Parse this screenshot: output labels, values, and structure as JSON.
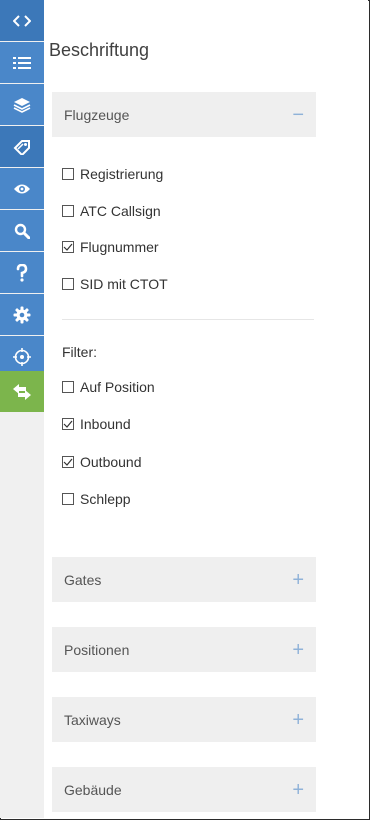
{
  "panel": {
    "title": "Beschriftung"
  },
  "sidebar": {
    "items": [
      {
        "icon": "code-brackets-icon",
        "state": "active-dark"
      },
      {
        "icon": "list-icon",
        "state": "active"
      },
      {
        "icon": "layers-icon",
        "state": "active"
      },
      {
        "icon": "tag-icon",
        "state": "active-dark"
      },
      {
        "icon": "eye-icon",
        "state": "active"
      },
      {
        "icon": "search-icon",
        "state": "active"
      },
      {
        "icon": "help-icon",
        "state": "active"
      },
      {
        "icon": "gear-icon",
        "state": "active"
      },
      {
        "icon": "crosshair-icon",
        "state": "active"
      },
      {
        "icon": "swap-arrows-icon",
        "state": "highlight"
      }
    ],
    "colors": {
      "blue": "#4a87c9",
      "blue_dark": "#3c78b9",
      "green": "#7cb54c"
    }
  },
  "sections": {
    "flugzeuge": {
      "label": "Flugzeuge",
      "toggle": "−",
      "expanded": true,
      "options": [
        {
          "label": "Registrierung",
          "checked": false
        },
        {
          "label": "ATC Callsign",
          "checked": false
        },
        {
          "label": "Flugnummer",
          "checked": true
        },
        {
          "label": "SID mit CTOT",
          "checked": false
        }
      ],
      "filter_label": "Filter:",
      "filters": [
        {
          "label": "Auf Position",
          "checked": false
        },
        {
          "label": "Inbound",
          "checked": true
        },
        {
          "label": "Outbound",
          "checked": true
        },
        {
          "label": "Schlepp",
          "checked": false
        }
      ]
    },
    "gates": {
      "label": "Gates",
      "toggle": "+",
      "expanded": false
    },
    "positionen": {
      "label": "Positionen",
      "toggle": "+",
      "expanded": false
    },
    "taxiways": {
      "label": "Taxiways",
      "toggle": "+",
      "expanded": false
    },
    "gebaeude": {
      "label": "Gebäude",
      "toggle": "+",
      "expanded": false
    }
  }
}
